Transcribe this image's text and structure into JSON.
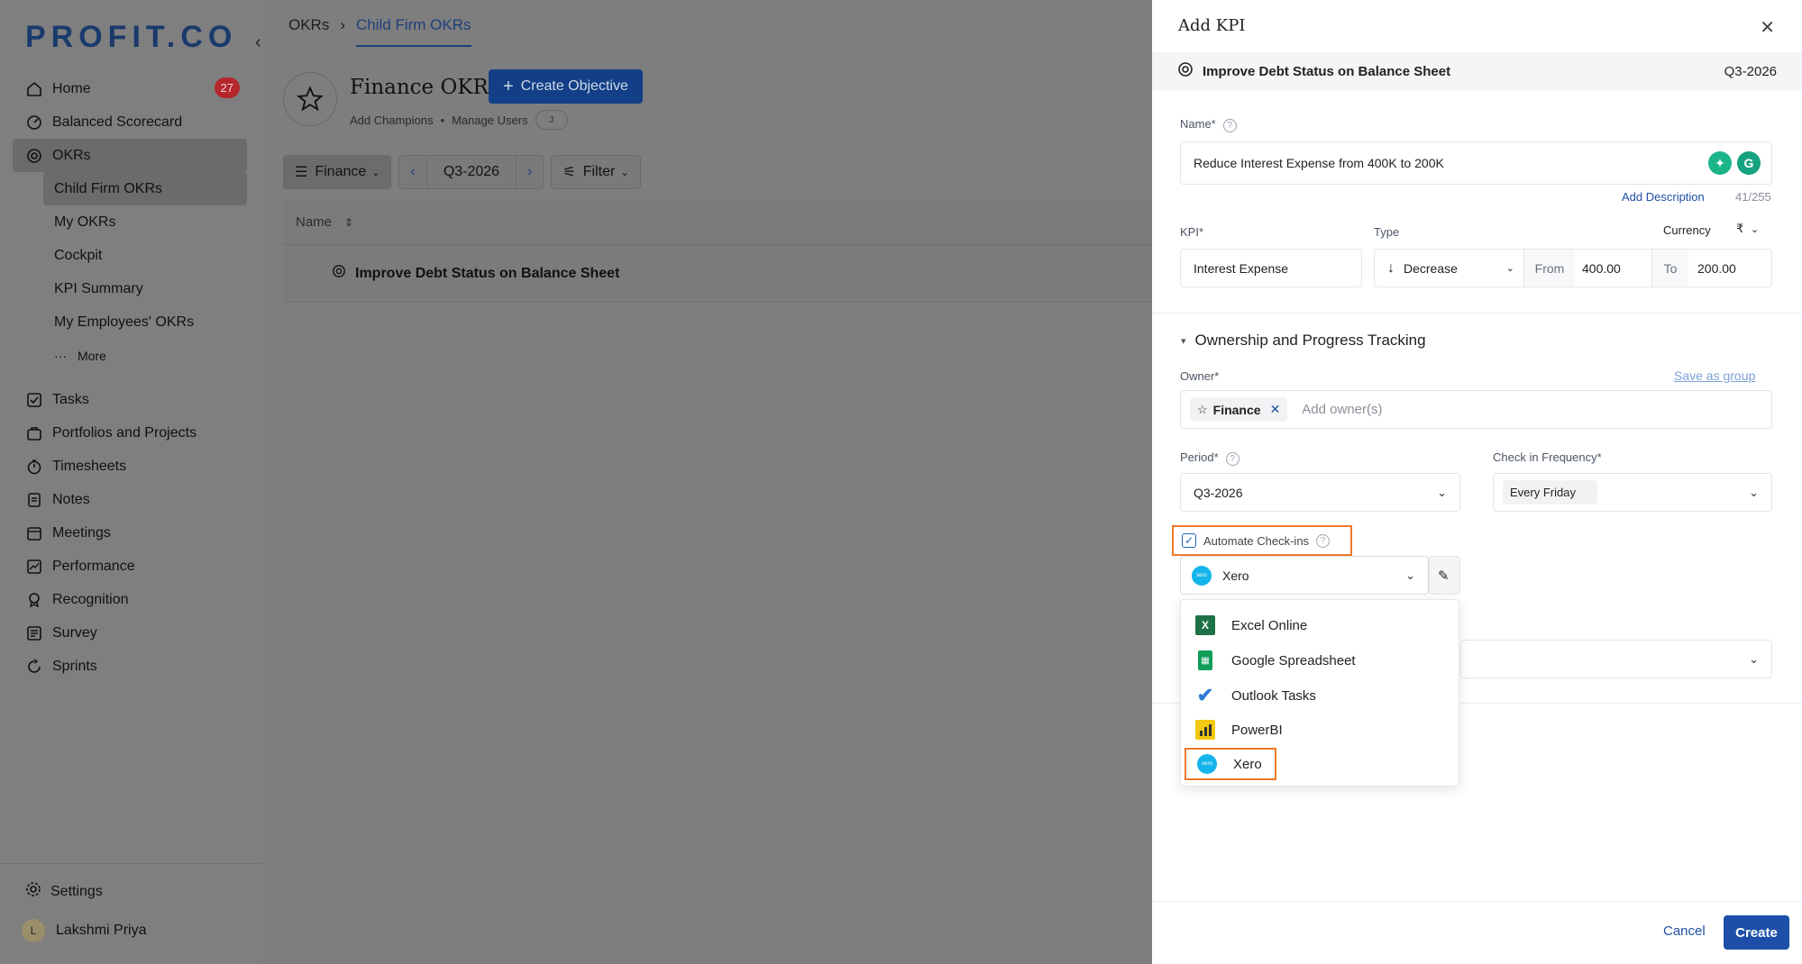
{
  "sidebar": {
    "logo": "PROFIT.CO",
    "collapse_icon": "chevron-left-icon",
    "items": [
      {
        "label": "Home",
        "icon": "home-icon",
        "badge": "27"
      },
      {
        "label": "Balanced Scorecard",
        "icon": "scorecard-icon"
      },
      {
        "label": "OKRs",
        "icon": "target-icon"
      },
      {
        "label": "Child Firm OKRs"
      },
      {
        "label": "My OKRs"
      },
      {
        "label": "Cockpit"
      },
      {
        "label": "KPI Summary"
      },
      {
        "label": "My Employees' OKRs"
      },
      {
        "label": "More",
        "icon": "ellipsis-icon"
      },
      {
        "label": "Tasks",
        "icon": "tasks-icon"
      },
      {
        "label": "Portfolios and Projects",
        "icon": "briefcase-icon"
      },
      {
        "label": "Timesheets",
        "icon": "stopwatch-icon"
      },
      {
        "label": "Notes",
        "icon": "notes-icon"
      },
      {
        "label": "Meetings",
        "icon": "meetings-icon"
      },
      {
        "label": "Performance",
        "icon": "chart-icon"
      },
      {
        "label": "Recognition",
        "icon": "award-icon"
      },
      {
        "label": "Survey",
        "icon": "survey-icon"
      },
      {
        "label": "Sprints",
        "icon": "sprint-icon"
      }
    ],
    "settings": "Settings",
    "user": {
      "initial": "L",
      "name": "Lakshmi Priya"
    }
  },
  "main": {
    "breadcrumb": {
      "root": "OKRs",
      "current": "Child Firm OKRs"
    },
    "title": "Finance OKRs",
    "create_objective": "Create Objective",
    "add_champions": "Add Champions",
    "bullet": "•",
    "manage_users": "Manage Users",
    "avatar_initial": "J",
    "toolbar": {
      "group": "Finance",
      "period": "Q3-2026",
      "filter": "Filter"
    },
    "table": {
      "header": "Name",
      "row": "Improve Debt Status on Balance Sheet"
    }
  },
  "drawer": {
    "title": "Add KPI",
    "objective": "Improve Debt Status on Balance Sheet",
    "objective_period": "Q3-2026",
    "name_label": "Name*",
    "name_value": "Reduce Interest Expense from 400K to 200K",
    "add_description": "Add Description",
    "char_count": "41/255",
    "kpi_label": "KPI*",
    "kpi_value": "Interest Expense",
    "type_label": "Type",
    "type_value": "Decrease",
    "currency_label": "Currency",
    "currency_symbol": "₹",
    "from_label": "From",
    "from_value": "400.00",
    "to_label": "To",
    "to_value": "200.00",
    "section": "Ownership and Progress Tracking",
    "owner_label": "Owner*",
    "save_as_group": "Save as group",
    "owner_chip": "Finance",
    "owner_placeholder": "Add owner(s)",
    "period_label": "Period*",
    "period_value": "Q3-2026",
    "freq_label": "Check in Frequency*",
    "freq_value": "Every Friday",
    "automate_label": "Automate Check-ins",
    "integration_value": "Xero",
    "integration_options": [
      "Excel Online",
      "Google Spreadsheet",
      "Outlook Tasks",
      "PowerBI",
      "Xero"
    ],
    "cancel": "Cancel",
    "create": "Create"
  },
  "colors": {
    "brand_blue": "#1d4fa8",
    "highlight_orange": "#f07a2a",
    "badge_red": "#b5262d",
    "xero_cyan": "#13b5ea"
  }
}
